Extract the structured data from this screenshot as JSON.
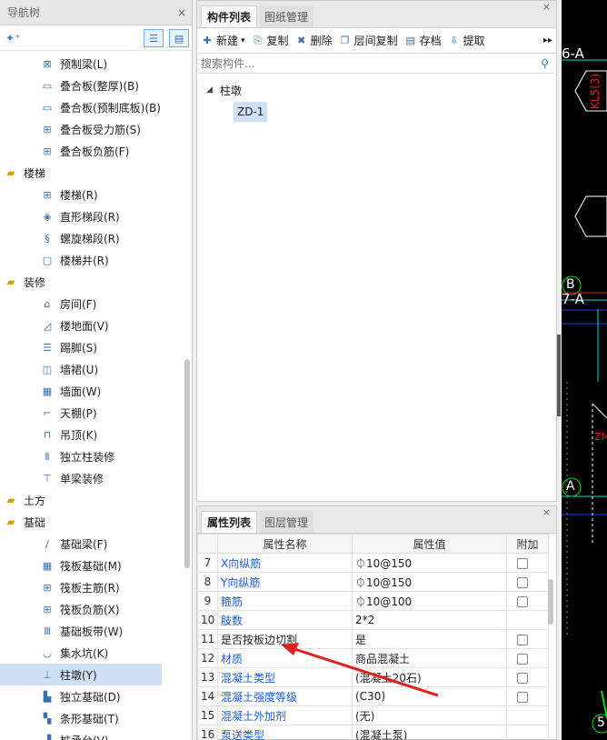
{
  "nav": {
    "title": "导航树",
    "close": "×",
    "items": [
      {
        "type": "leaf",
        "label": "预制梁(L)",
        "icon": "precast-beam-icon",
        "g": "⊠"
      },
      {
        "type": "leaf",
        "label": "叠合板(整厚)(B)",
        "icon": "composite-slab-icon",
        "g": "▭"
      },
      {
        "type": "leaf",
        "label": "叠合板(预制底板)(B)",
        "icon": "precast-bottom-slab-icon",
        "g": "▭"
      },
      {
        "type": "leaf",
        "label": "叠合板受力筋(S)",
        "icon": "slab-rebar-icon",
        "g": "⊞"
      },
      {
        "type": "leaf",
        "label": "叠合板负筋(F)",
        "icon": "slab-neg-rebar-icon",
        "g": "⊞"
      },
      {
        "type": "cat",
        "label": "楼梯",
        "icon": "folder-icon",
        "g": "▰"
      },
      {
        "type": "leaf",
        "label": "楼梯(R)",
        "icon": "stair-icon",
        "g": "⊞"
      },
      {
        "type": "leaf",
        "label": "直形梯段(R)",
        "icon": "straight-flight-icon",
        "g": "◈"
      },
      {
        "type": "leaf",
        "label": "螺旋梯段(R)",
        "icon": "spiral-flight-icon",
        "g": "§"
      },
      {
        "type": "leaf",
        "label": "楼梯井(R)",
        "icon": "stairwell-icon",
        "g": "▢"
      },
      {
        "type": "cat",
        "label": "装修",
        "icon": "folder-icon",
        "g": "▰"
      },
      {
        "type": "leaf",
        "label": "房间(F)",
        "icon": "room-icon",
        "g": "⌂"
      },
      {
        "type": "leaf",
        "label": "楼地面(V)",
        "icon": "floor-icon",
        "g": "◿"
      },
      {
        "type": "leaf",
        "label": "踢脚(S)",
        "icon": "skirting-icon",
        "g": "☰"
      },
      {
        "type": "leaf",
        "label": "墙裙(U)",
        "icon": "dado-icon",
        "g": "◫"
      },
      {
        "type": "leaf",
        "label": "墙面(W)",
        "icon": "wall-surface-icon",
        "g": "▦"
      },
      {
        "type": "leaf",
        "label": "天棚(P)",
        "icon": "ceiling-icon",
        "g": "⌐"
      },
      {
        "type": "leaf",
        "label": "吊顶(K)",
        "icon": "suspended-ceiling-icon",
        "g": "⊓"
      },
      {
        "type": "leaf",
        "label": "独立柱装修",
        "icon": "column-finish-icon",
        "g": "Ⅱ"
      },
      {
        "type": "leaf",
        "label": "单梁装修",
        "icon": "beam-finish-icon",
        "g": "⊤"
      },
      {
        "type": "cat",
        "label": "土方",
        "icon": "folder-icon",
        "g": "▰"
      },
      {
        "type": "cat",
        "label": "基础",
        "icon": "folder-icon",
        "g": "▰"
      },
      {
        "type": "leaf",
        "label": "基础梁(F)",
        "icon": "foundation-beam-icon",
        "g": "∕"
      },
      {
        "type": "leaf",
        "label": "筏板基础(M)",
        "icon": "raft-foundation-icon",
        "g": "▦"
      },
      {
        "type": "leaf",
        "label": "筏板主筋(R)",
        "icon": "raft-main-rebar-icon",
        "g": "⊞"
      },
      {
        "type": "leaf",
        "label": "筏板负筋(X)",
        "icon": "raft-neg-rebar-icon",
        "g": "⊞"
      },
      {
        "type": "leaf",
        "label": "基础板带(W)",
        "icon": "foundation-strip-icon",
        "g": "Ⅲ"
      },
      {
        "type": "leaf",
        "label": "集水坑(K)",
        "icon": "sump-pit-icon",
        "g": "◡"
      },
      {
        "type": "leaf",
        "label": "柱墩(Y)",
        "icon": "column-pier-icon",
        "g": "⊥",
        "selected": true
      },
      {
        "type": "leaf",
        "label": "独立基础(D)",
        "icon": "isolated-foundation-icon",
        "g": "▙"
      },
      {
        "type": "leaf",
        "label": "条形基础(T)",
        "icon": "strip-foundation-icon",
        "g": "▚"
      },
      {
        "type": "leaf",
        "label": "桩承台(V)",
        "icon": "pile-cap-icon",
        "g": "▟"
      }
    ]
  },
  "components": {
    "tabs": [
      "构件列表",
      "图纸管理"
    ],
    "close": "×",
    "toolbar": [
      {
        "label": "新建",
        "icon": "new-icon",
        "g": "✚",
        "caret": "▾"
      },
      {
        "label": "复制",
        "icon": "copy-icon",
        "g": "⎘"
      },
      {
        "label": "删除",
        "icon": "delete-icon",
        "g": "✖"
      },
      {
        "label": "层间复制",
        "icon": "layer-copy-icon",
        "g": "❐"
      },
      {
        "label": "存档",
        "icon": "archive-icon",
        "g": "▤"
      },
      {
        "label": "提取",
        "icon": "extract-icon",
        "g": "⇩"
      }
    ],
    "more": "▸▸",
    "search_placeholder": "搜索构件...",
    "tree_root": "柱墩",
    "tree_child": "ZD-1"
  },
  "properties": {
    "tabs": [
      "属性列表",
      "图层管理"
    ],
    "close": "×",
    "headers": [
      "属性名称",
      "属性值",
      "附加"
    ],
    "rows": [
      {
        "n": "7",
        "name": "X向纵筋",
        "value": "⏀10@150",
        "blue": true,
        "cb": true
      },
      {
        "n": "8",
        "name": "Y向纵筋",
        "value": "⏀10@150",
        "blue": true,
        "cb": true
      },
      {
        "n": "9",
        "name": "箍筋",
        "value": "⏀10@100",
        "blue": true,
        "cb": true
      },
      {
        "n": "10",
        "name": "肢数",
        "value": "2*2",
        "blue": true,
        "cb": false
      },
      {
        "n": "11",
        "name": "是否按板边切割",
        "value": "是",
        "blue": false,
        "cb": true
      },
      {
        "n": "12",
        "name": "材质",
        "value": "商品混凝土",
        "blue": true,
        "cb": true
      },
      {
        "n": "13",
        "name": "混凝土类型",
        "value": "(混凝土20石)",
        "blue": true,
        "cb": true
      },
      {
        "n": "14",
        "name": "混凝土强度等级",
        "value": "(C30)",
        "blue": true,
        "cb": true
      },
      {
        "n": "15",
        "name": "混凝土外加剂",
        "value": "(无)",
        "blue": true,
        "cb": false
      },
      {
        "n": "16",
        "name": "泵送类型",
        "value": "(混凝土泵)",
        "blue": true,
        "cb": false
      }
    ]
  },
  "canvas": {
    "labels": [
      "6-A",
      "KL5(3)",
      "B",
      "7-A",
      "A",
      "ZM",
      "5"
    ],
    "colors": {
      "cyan": "#00d7d7",
      "green": "#00e000",
      "blue": "#1a3cff",
      "red": "#e02020",
      "white": "#ffffff"
    }
  },
  "annotation": {
    "arrow_color": "#e02020"
  }
}
